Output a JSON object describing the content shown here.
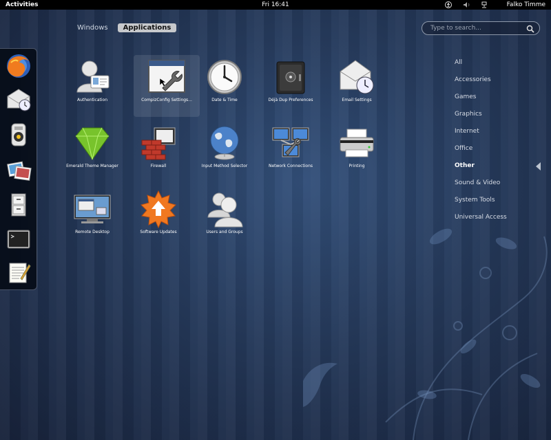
{
  "topbar": {
    "activities": "Activities",
    "clock": "Fri 16:41",
    "user": "Falko Timme"
  },
  "views": {
    "windows": "Windows",
    "applications": "Applications"
  },
  "search": {
    "placeholder": "Type to search..."
  },
  "dash": {
    "items": [
      "firefox-icon",
      "evolution-mail-icon",
      "rhythmbox-icon",
      "shotwell-photos-icon",
      "file-cabinet-icon",
      "terminal-icon",
      "text-editor-icon"
    ]
  },
  "apps": [
    {
      "label": "Authentication",
      "icon": "authentication-icon"
    },
    {
      "label": "CompizConfig Settings...",
      "icon": "compizconfig-icon"
    },
    {
      "label": "Date & Time",
      "icon": "clock-icon"
    },
    {
      "label": "Déjà Dup Preferences",
      "icon": "safe-icon"
    },
    {
      "label": "Email Settings",
      "icon": "email-settings-icon"
    },
    {
      "label": "Emerald Theme Manager",
      "icon": "emerald-gem-icon"
    },
    {
      "label": "Firewall",
      "icon": "firewall-icon"
    },
    {
      "label": "Input Method Selector",
      "icon": "globe-icon"
    },
    {
      "label": "Network Connections",
      "icon": "network-icon"
    },
    {
      "label": "Printing",
      "icon": "printer-icon"
    },
    {
      "label": "Remote Desktop",
      "icon": "remote-desktop-icon"
    },
    {
      "label": "Software Updates",
      "icon": "software-update-icon"
    },
    {
      "label": "Users and Groups",
      "icon": "users-icon"
    }
  ],
  "categories": [
    "All",
    "Accessories",
    "Games",
    "Graphics",
    "Internet",
    "Office",
    "Other",
    "Sound & Video",
    "System Tools",
    "Universal Access"
  ],
  "selected_category": "Other"
}
